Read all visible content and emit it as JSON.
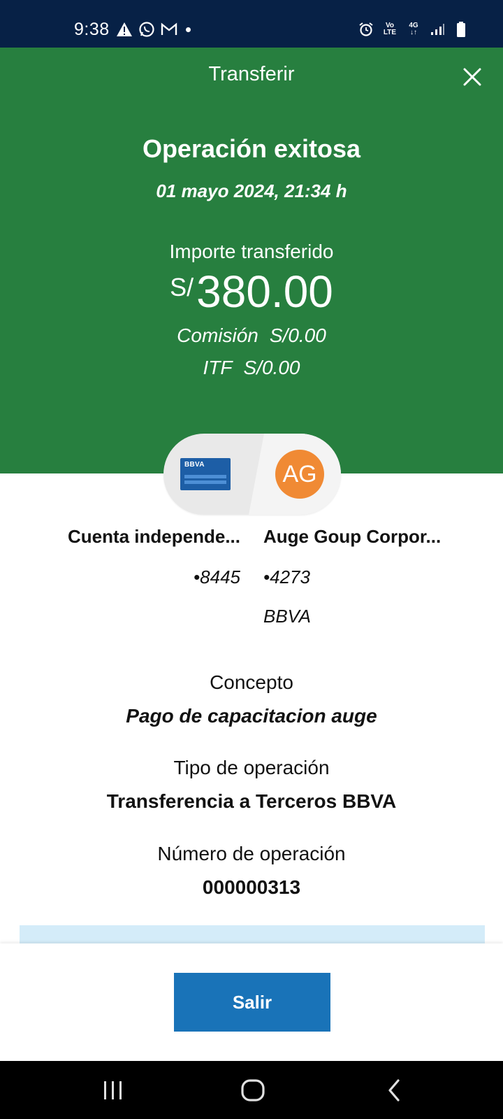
{
  "status_bar": {
    "time": "9:38",
    "left_icons": [
      "alert-triangle-icon",
      "whatsapp-icon",
      "gmail-icon",
      "notification-dot-icon"
    ],
    "right_icons": [
      "alarm-icon",
      "volte-icon",
      "4g-icon",
      "signal-icon",
      "battery-icon"
    ],
    "volte_top": "Vo",
    "volte_bottom": "LTE",
    "network": "4G"
  },
  "header": {
    "title": "Transferir",
    "close_icon": "close-icon",
    "success_title": "Operación exitosa",
    "date": "01 mayo 2024, 21:34 h",
    "amount_label": "Importe transferido",
    "currency": "S/",
    "amount": "380.00",
    "commission_label": "Comisión",
    "commission_value": "S/0.00",
    "itf_label": "ITF",
    "itf_value": "S/0.00",
    "background_color": "#277f3f"
  },
  "transfer": {
    "origin_card_label": "BBVA",
    "destination_initials": "AG",
    "avatar_color": "#f08a34",
    "origin": {
      "name": "Cuenta independe...",
      "number": "•8445"
    },
    "destination": {
      "name": "Auge Goup Corpor...",
      "number": "•4273",
      "bank": "BBVA"
    }
  },
  "details": {
    "concept_label": "Concepto",
    "concept_value": "Pago de capacitacion auge",
    "type_label": "Tipo de operación",
    "type_value": "Transferencia a Terceros BBVA",
    "operation_number_label": "Número de operación",
    "operation_number_value": "000000313"
  },
  "actions": {
    "exit_label": "Salir",
    "button_color": "#1973b8"
  },
  "nav_bar": {
    "buttons": [
      "recent-apps-icon",
      "home-icon",
      "back-icon"
    ]
  }
}
